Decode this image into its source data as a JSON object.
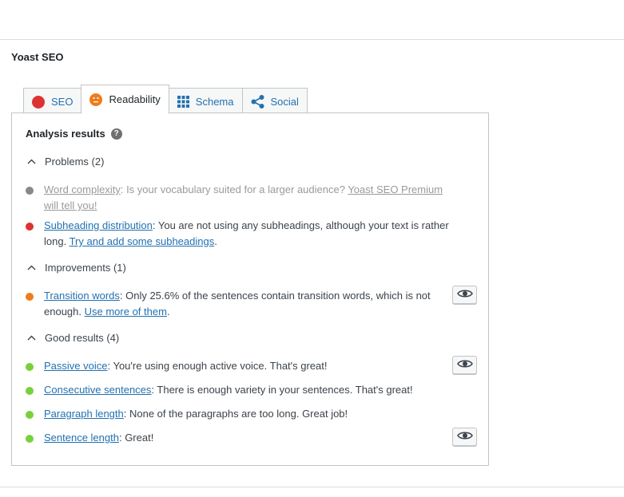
{
  "panel": {
    "title": "Yoast SEO"
  },
  "tabs": [
    {
      "label": "SEO",
      "icon": "red-dot-icon",
      "color": "#dc3232"
    },
    {
      "label": "Readability",
      "icon": "orange-face-icon",
      "color": "#ee7c1b"
    },
    {
      "label": "Schema",
      "icon": "grid-icon",
      "color": "#2271b1"
    },
    {
      "label": "Social",
      "icon": "share-icon",
      "color": "#2271b1"
    }
  ],
  "analysis": {
    "title": "Analysis results",
    "help_icon": "?",
    "colors": {
      "gray": "#888888",
      "red": "#dc3232",
      "orange": "#ee7c1b",
      "green": "#7ad03a"
    },
    "problems": {
      "heading": "Problems (2)",
      "items": [
        {
          "link": "Word complexity",
          "text": ": Is your vocabulary suited for a larger audience? ",
          "link2": "Yoast SEO Premium will tell you!",
          "after": ""
        },
        {
          "link": "Subheading distribution",
          "text": ": You are not using any subheadings, although your text is rather long. ",
          "link2": "Try and add some subheadings",
          "after": "."
        }
      ]
    },
    "improvements": {
      "heading": "Improvements (1)",
      "items": [
        {
          "link": "Transition words",
          "text": ": Only 25.6% of the sentences contain transition words, which is not enough. ",
          "link2": "Use more of them",
          "after": "."
        }
      ]
    },
    "good": {
      "heading": "Good results (4)",
      "items": [
        {
          "link": "Passive voice",
          "text": ": You're using enough active voice. That's great!"
        },
        {
          "link": "Consecutive sentences",
          "text": ": There is enough variety in your sentences. That's great!"
        },
        {
          "link": "Paragraph length",
          "text": ": None of the paragraphs are too long. Great job!"
        },
        {
          "link": "Sentence length",
          "text": ": Great!"
        }
      ]
    }
  }
}
